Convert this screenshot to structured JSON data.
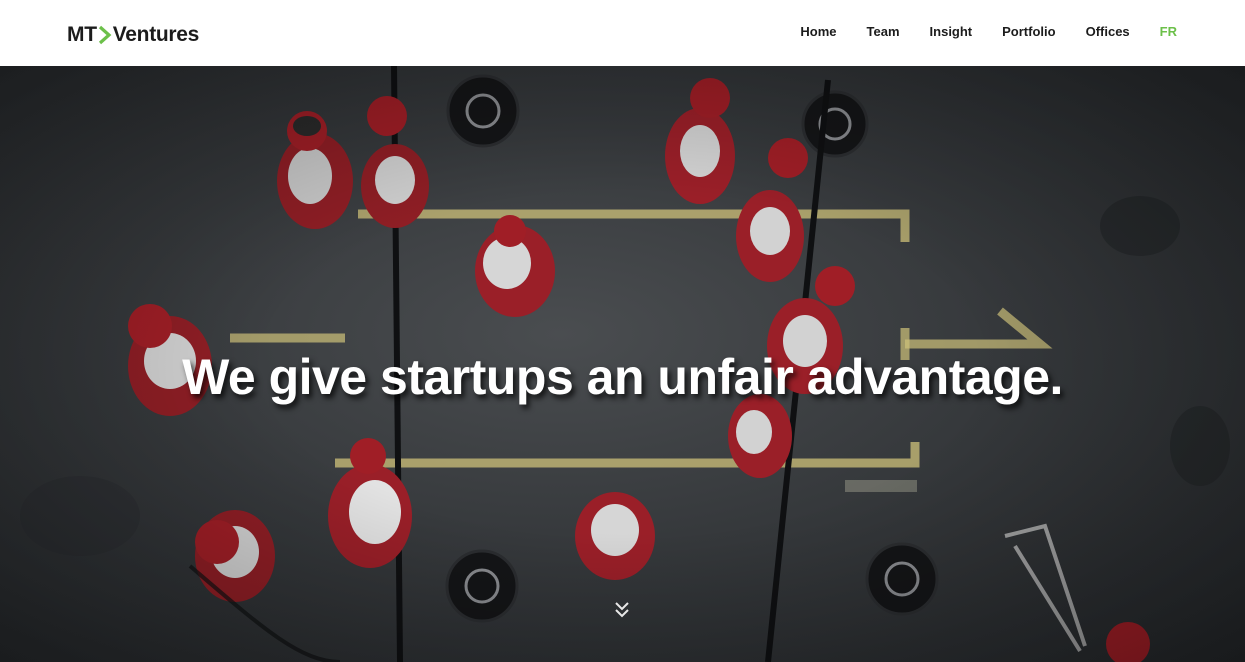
{
  "header": {
    "logo": {
      "left": "MT",
      "right": "Ventures",
      "chevron_color": "#6cc04a"
    },
    "nav": [
      {
        "label": "Home"
      },
      {
        "label": "Team"
      },
      {
        "label": "Insight"
      },
      {
        "label": "Portfolio"
      },
      {
        "label": "Offices"
      },
      {
        "label": "FR"
      }
    ],
    "accent_color": "#6cc04a"
  },
  "hero": {
    "headline": "We give startups an unfair advantage.",
    "scroll_icon": "double-chevron-down-icon"
  }
}
